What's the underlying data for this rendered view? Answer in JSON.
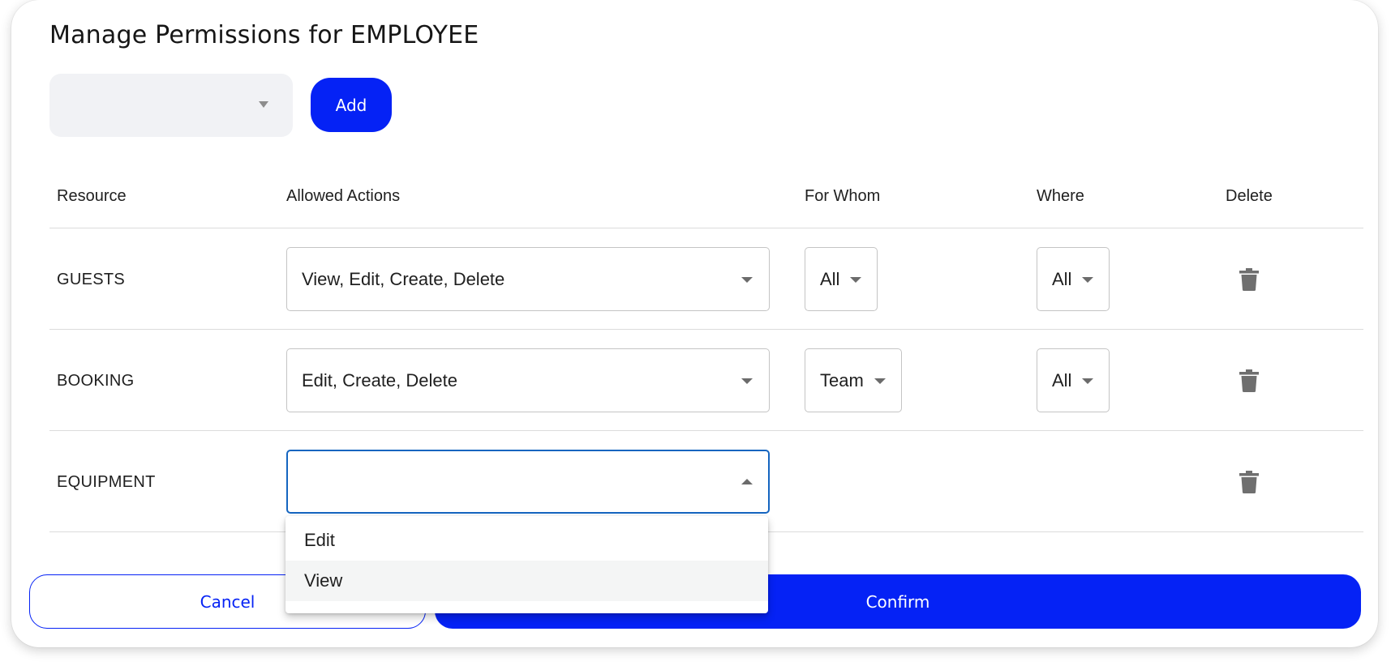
{
  "dialog": {
    "title": "Manage Permissions for EMPLOYEE"
  },
  "add_resource": {
    "selected_value": "",
    "add_label": "Add"
  },
  "table": {
    "headers": {
      "resource": "Resource",
      "allowed_actions": "Allowed Actions",
      "for_whom": "For Whom",
      "where": "Where",
      "delete": "Delete"
    },
    "rows": [
      {
        "resource": "GUESTS",
        "allowed_actions": "View, Edit, Create, Delete",
        "for_whom": "All",
        "where": "All"
      },
      {
        "resource": "BOOKING",
        "allowed_actions": "Edit, Create, Delete",
        "for_whom": "Team",
        "where": "All"
      },
      {
        "resource": "EQUIPMENT",
        "allowed_actions": "",
        "for_whom": null,
        "where": null
      }
    ]
  },
  "actions_menu": {
    "open_for_row": "EQUIPMENT",
    "options": [
      "Edit",
      "View"
    ],
    "hovered_option": "View"
  },
  "footer": {
    "cancel_label": "Cancel",
    "confirm_label": "Confirm"
  },
  "colors": {
    "primary": "#0522f5",
    "focus_border": "#1565c0",
    "select_bg": "#f1f2f5"
  },
  "icons": {
    "delete": "trash-icon",
    "dropdown": "caret-down-icon",
    "dropdown_open": "caret-up-icon"
  }
}
